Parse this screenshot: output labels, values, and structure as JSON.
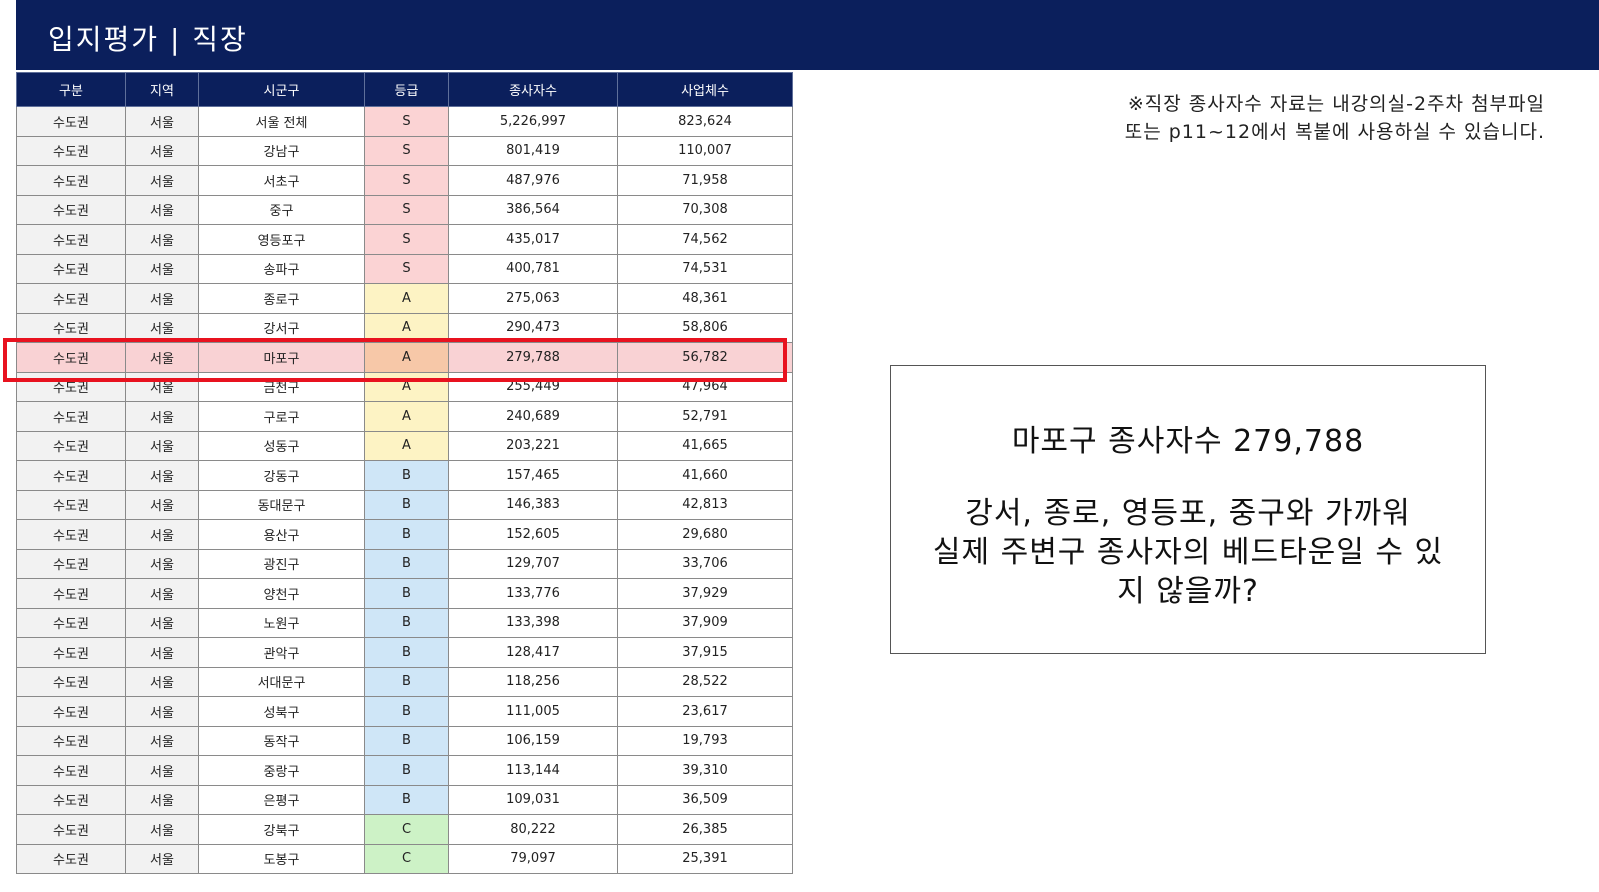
{
  "header": {
    "title": "입지평가 | 직장"
  },
  "table": {
    "columns": [
      "구분",
      "지역",
      "시군구",
      "등급",
      "종사자수",
      "사업체수"
    ],
    "rows": [
      [
        "수도권",
        "서울",
        "서울 전체",
        "S",
        "5,226,997",
        "823,624"
      ],
      [
        "수도권",
        "서울",
        "강남구",
        "S",
        "801,419",
        "110,007"
      ],
      [
        "수도권",
        "서울",
        "서초구",
        "S",
        "487,976",
        "71,958"
      ],
      [
        "수도권",
        "서울",
        "중구",
        "S",
        "386,564",
        "70,308"
      ],
      [
        "수도권",
        "서울",
        "영등포구",
        "S",
        "435,017",
        "74,562"
      ],
      [
        "수도권",
        "서울",
        "송파구",
        "S",
        "400,781",
        "74,531"
      ],
      [
        "수도권",
        "서울",
        "종로구",
        "A",
        "275,063",
        "48,361"
      ],
      [
        "수도권",
        "서울",
        "강서구",
        "A",
        "290,473",
        "58,806"
      ],
      [
        "수도권",
        "서울",
        "마포구",
        "A",
        "279,788",
        "56,782"
      ],
      [
        "수도권",
        "서울",
        "금천구",
        "A",
        "255,449",
        "47,964"
      ],
      [
        "수도권",
        "서울",
        "구로구",
        "A",
        "240,689",
        "52,791"
      ],
      [
        "수도권",
        "서울",
        "성동구",
        "A",
        "203,221",
        "41,665"
      ],
      [
        "수도권",
        "서울",
        "강동구",
        "B",
        "157,465",
        "41,660"
      ],
      [
        "수도권",
        "서울",
        "동대문구",
        "B",
        "146,383",
        "42,813"
      ],
      [
        "수도권",
        "서울",
        "용산구",
        "B",
        "152,605",
        "29,680"
      ],
      [
        "수도권",
        "서울",
        "광진구",
        "B",
        "129,707",
        "33,706"
      ],
      [
        "수도권",
        "서울",
        "양천구",
        "B",
        "133,776",
        "37,929"
      ],
      [
        "수도권",
        "서울",
        "노원구",
        "B",
        "133,398",
        "37,909"
      ],
      [
        "수도권",
        "서울",
        "관악구",
        "B",
        "128,417",
        "37,915"
      ],
      [
        "수도권",
        "서울",
        "서대문구",
        "B",
        "118,256",
        "28,522"
      ],
      [
        "수도권",
        "서울",
        "성북구",
        "B",
        "111,005",
        "23,617"
      ],
      [
        "수도권",
        "서울",
        "동작구",
        "B",
        "106,159",
        "19,793"
      ],
      [
        "수도권",
        "서울",
        "중랑구",
        "B",
        "113,144",
        "39,310"
      ],
      [
        "수도권",
        "서울",
        "은평구",
        "B",
        "109,031",
        "36,509"
      ],
      [
        "수도권",
        "서울",
        "강북구",
        "C",
        "80,222",
        "26,385"
      ],
      [
        "수도권",
        "서울",
        "도봉구",
        "C",
        "79,097",
        "25,391"
      ]
    ],
    "highlighted_row": 8
  },
  "note": {
    "line1": "※직장 종사자수 자료는 내강의실-2주차 첨부파일",
    "line2": "또는 p11~12에서 복붙에 사용하실 수 있습니다."
  },
  "callout": {
    "headline": "마포구 종사자수 279,788",
    "body_line1": "강서, 종로, 영등포, 중구와 가까워",
    "body_line2": "실제 주변구 종사자의 베드타운일 수 있",
    "body_line3": "지 않을까?"
  },
  "colors": {
    "header_navy": "#0b1f5c",
    "grade_S": "#fbd3d4",
    "grade_A": "#fdf3c4",
    "grade_B": "#cfe6f7",
    "grade_C": "#cdf2c6",
    "highlight_border": "#e8121f"
  }
}
